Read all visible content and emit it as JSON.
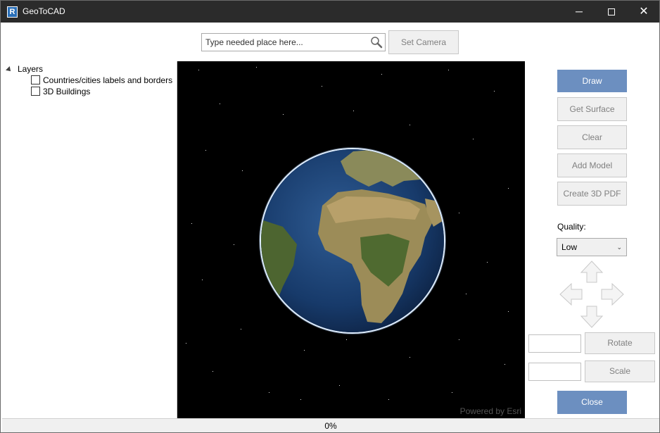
{
  "window": {
    "title": "GeoToCAD",
    "app_icon_letter": "R",
    "minimize_glyph": "─",
    "close_glyph": "✕"
  },
  "search": {
    "placeholder": "Type needed place here...",
    "value": "",
    "icon": "search-icon"
  },
  "toolbar": {
    "set_camera_label": "Set Camera"
  },
  "layers": {
    "root_label": "Layers",
    "items": [
      {
        "label": "Countries/cities labels and borders",
        "checked": false
      },
      {
        "label": "3D Buildings",
        "checked": false
      }
    ]
  },
  "map": {
    "attribution": "Powered by Esri"
  },
  "actions": {
    "draw_label": "Draw",
    "get_surface_label": "Get Surface",
    "clear_label": "Clear",
    "add_model_label": "Add Model",
    "create_pdf_label": "Create 3D PDF",
    "quality_label": "Quality:",
    "quality_value": "Low",
    "rotate_label": "Rotate",
    "rotate_value": "",
    "scale_label": "Scale",
    "scale_value": "",
    "close_label": "Close"
  },
  "status": {
    "progress_text": "0%",
    "progress": 0
  },
  "colors": {
    "accent": "#6c8fc0",
    "titlebar": "#2b2b2b",
    "disabled_text": "#808080"
  }
}
